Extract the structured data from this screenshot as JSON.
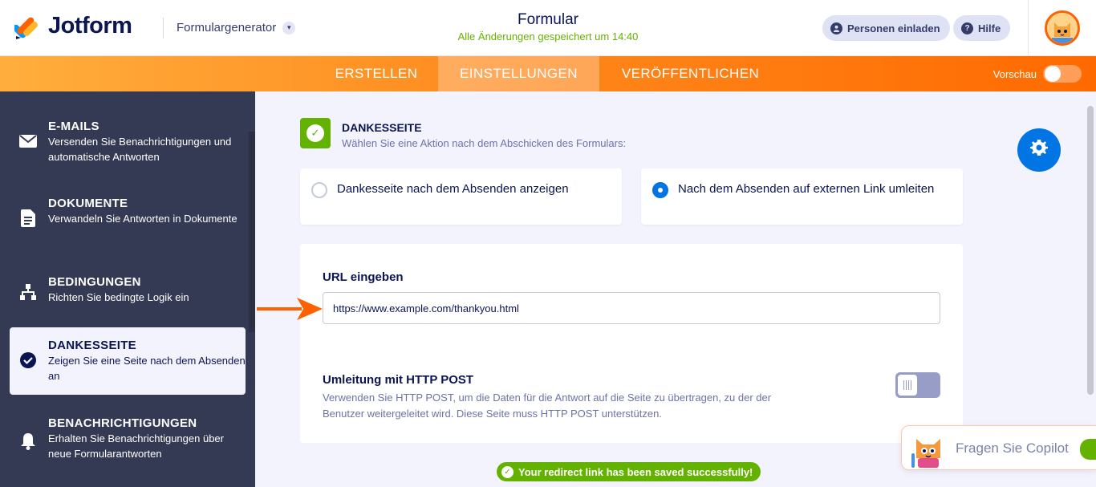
{
  "header": {
    "logo_text": "Jotform",
    "builder_label": "Formulargenerator",
    "form_title": "Formular",
    "save_status": "Alle Änderungen gespeichert um 14:40",
    "invite_label": "Personen einladen",
    "help_label": "Hilfe"
  },
  "nav": {
    "tabs": [
      "ERSTELLEN",
      "EINSTELLUNGEN",
      "VERÖFFENTLICHEN"
    ],
    "active_tab": "EINSTELLUNGEN",
    "preview_label": "Vorschau"
  },
  "sidebar": {
    "items": [
      {
        "title": "E-MAILS",
        "desc": "Versenden Sie Benachrichtigungen und automatische Antworten",
        "icon": "mail-icon"
      },
      {
        "title": "DOKUMENTE",
        "desc": "Verwandeln Sie Antworten in Dokumente",
        "icon": "document-icon"
      },
      {
        "title": "BEDINGUNGEN",
        "desc": "Richten Sie bedingte Logik ein",
        "icon": "sitemap-icon"
      },
      {
        "title": "DANKESSEITE",
        "desc": "Zeigen Sie eine Seite nach dem Absenden an",
        "icon": "check-circle-icon"
      },
      {
        "title": "BENACHRICHTIGUNGEN",
        "desc": "Erhalten Sie Benachrichtigungen über neue Formularantworten",
        "icon": "bell-icon"
      }
    ],
    "active_item": "DANKESSEITE"
  },
  "main": {
    "section_title": "DANKESSEITE",
    "section_subtitle": "Wählen Sie eine Aktion nach dem Abschicken des Formulars:",
    "options": [
      {
        "label": "Dankesseite nach dem Absenden anzeigen",
        "selected": false
      },
      {
        "label": "Nach dem Absenden auf externen Link umleiten",
        "selected": true
      }
    ],
    "url_label": "URL eingeben",
    "url_value": "https://www.example.com/thankyou.html",
    "post_label": "Umleitung mit HTTP POST",
    "post_desc": "Verwenden Sie HTTP POST, um die Daten für die Antwort auf die Seite zu übertragen, zu der der Benutzer weitergeleitet wird. Diese Seite muss HTTP POST unterstützen.",
    "post_enabled": false
  },
  "toast": "Your redirect link has been saved successfully!",
  "copilot_label": "Fragen Sie Copilot",
  "colors": {
    "accent_orange": "#ff6100",
    "sidebar_bg": "#343a53",
    "success_green": "#64b200",
    "primary_blue": "#0075e3"
  }
}
